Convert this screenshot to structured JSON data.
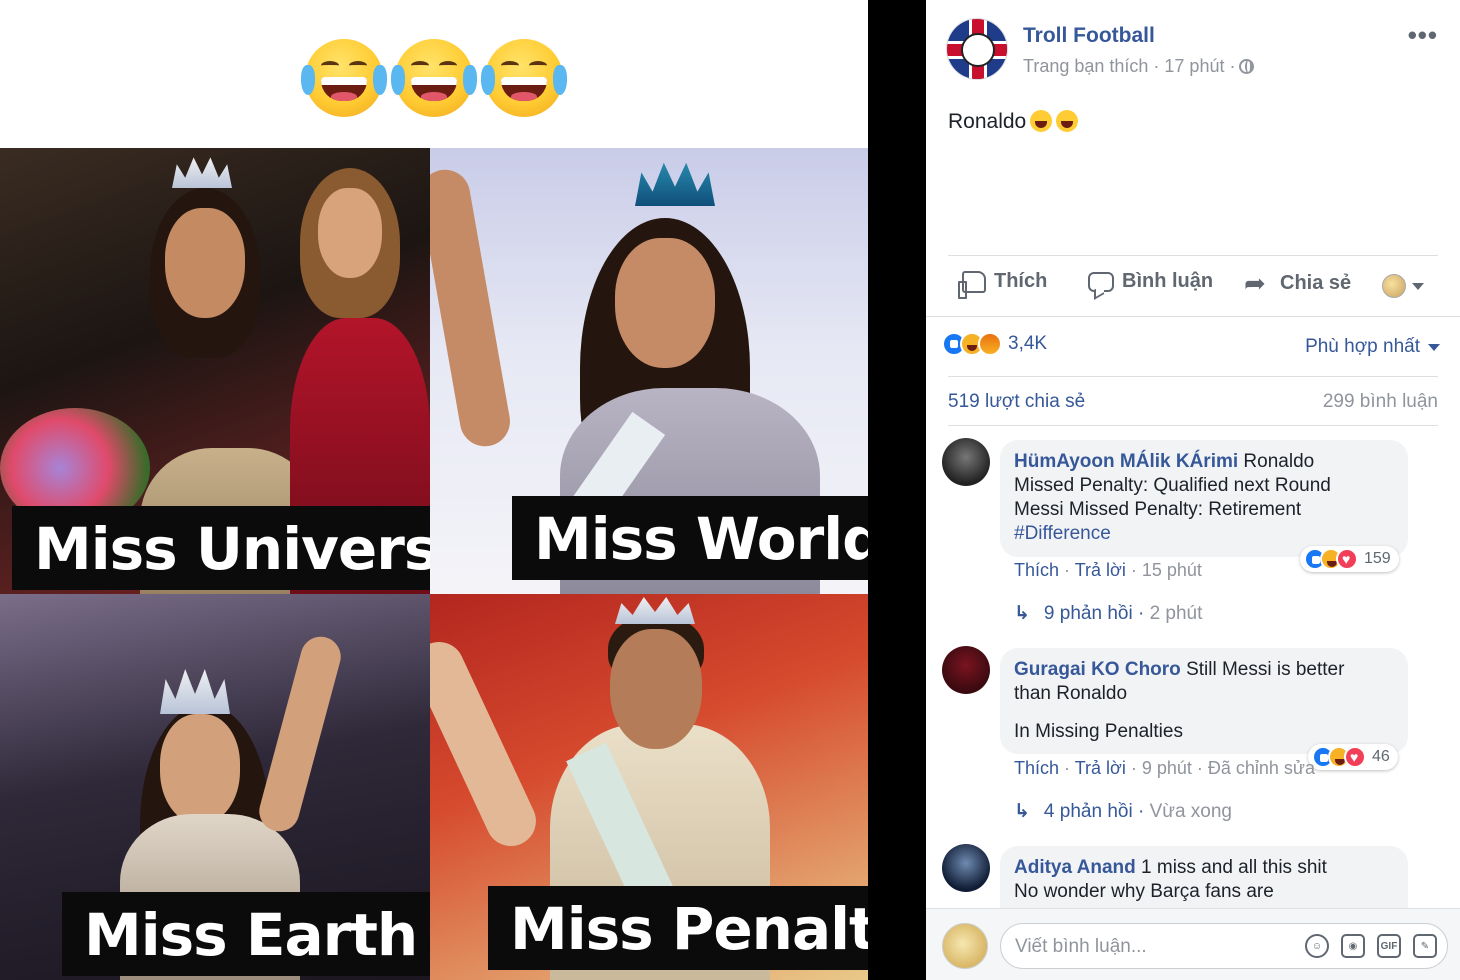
{
  "image": {
    "captions": [
      "Miss Universe",
      "Miss World",
      "Miss Earth",
      "Miss Penalty"
    ],
    "emoji_count": 3
  },
  "post": {
    "page_name": "Troll Football",
    "meta": "Trang bạn thích · 17 phút ·",
    "text": "Ronaldo",
    "more_label": "•••"
  },
  "actions": {
    "like": "Thích",
    "comment": "Bình luận",
    "share": "Chia sẻ"
  },
  "stats": {
    "reactions": "3,4K",
    "sort": "Phù hợp nhất",
    "shares": "519 lượt chia sẻ",
    "comments": "299 bình luận"
  },
  "comments": [
    {
      "author": "HümAyoon MÁlik KÁrimi",
      "text_inline": "Ronaldo",
      "lines": [
        "Missed Penalty: Qualified next Round",
        "Messi Missed Penalty: Retirement"
      ],
      "tag": "#Difference",
      "like": "Thích",
      "reply": "Trả lời",
      "time": "15 phút",
      "reactions": "159",
      "replies": "9 phản hồi",
      "replies_time": "2 phút"
    },
    {
      "author": "Guragai KO Choro",
      "text_inline": "Still Messi is better",
      "lines": [
        "than Ronaldo",
        "In Missing Penalties"
      ],
      "like": "Thích",
      "reply": "Trả lời",
      "time": "9 phút",
      "edited": "Đã chỉnh sửa",
      "reactions": "46",
      "replies": "4 phản hồi",
      "replies_time": "Vừa xong"
    },
    {
      "author": "Aditya Anand",
      "text_inline": "1 miss and all this shit",
      "lines": [
        "No wonder why Barça fans are"
      ]
    }
  ],
  "composer": {
    "placeholder": "Viết bình luận...",
    "gif_label": "GIF"
  },
  "colors": {
    "link": "#365899",
    "muted": "#90949c",
    "bubble": "#f2f3f5"
  }
}
